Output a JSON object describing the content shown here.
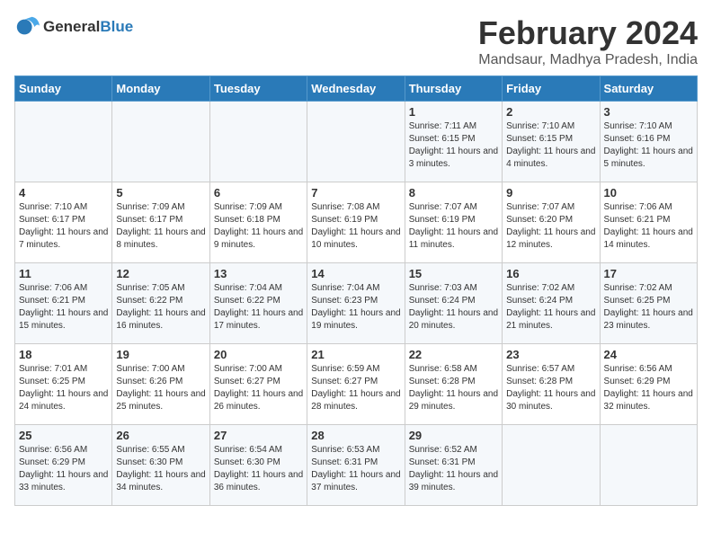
{
  "logo": {
    "general": "General",
    "blue": "Blue"
  },
  "title": "February 2024",
  "subtitle": "Mandsaur, Madhya Pradesh, India",
  "days_of_week": [
    "Sunday",
    "Monday",
    "Tuesday",
    "Wednesday",
    "Thursday",
    "Friday",
    "Saturday"
  ],
  "weeks": [
    [
      {
        "day": "",
        "info": ""
      },
      {
        "day": "",
        "info": ""
      },
      {
        "day": "",
        "info": ""
      },
      {
        "day": "",
        "info": ""
      },
      {
        "day": "1",
        "info": "Sunrise: 7:11 AM\nSunset: 6:15 PM\nDaylight: 11 hours and 3 minutes."
      },
      {
        "day": "2",
        "info": "Sunrise: 7:10 AM\nSunset: 6:15 PM\nDaylight: 11 hours and 4 minutes."
      },
      {
        "day": "3",
        "info": "Sunrise: 7:10 AM\nSunset: 6:16 PM\nDaylight: 11 hours and 5 minutes."
      }
    ],
    [
      {
        "day": "4",
        "info": "Sunrise: 7:10 AM\nSunset: 6:17 PM\nDaylight: 11 hours and 7 minutes."
      },
      {
        "day": "5",
        "info": "Sunrise: 7:09 AM\nSunset: 6:17 PM\nDaylight: 11 hours and 8 minutes."
      },
      {
        "day": "6",
        "info": "Sunrise: 7:09 AM\nSunset: 6:18 PM\nDaylight: 11 hours and 9 minutes."
      },
      {
        "day": "7",
        "info": "Sunrise: 7:08 AM\nSunset: 6:19 PM\nDaylight: 11 hours and 10 minutes."
      },
      {
        "day": "8",
        "info": "Sunrise: 7:07 AM\nSunset: 6:19 PM\nDaylight: 11 hours and 11 minutes."
      },
      {
        "day": "9",
        "info": "Sunrise: 7:07 AM\nSunset: 6:20 PM\nDaylight: 11 hours and 12 minutes."
      },
      {
        "day": "10",
        "info": "Sunrise: 7:06 AM\nSunset: 6:21 PM\nDaylight: 11 hours and 14 minutes."
      }
    ],
    [
      {
        "day": "11",
        "info": "Sunrise: 7:06 AM\nSunset: 6:21 PM\nDaylight: 11 hours and 15 minutes."
      },
      {
        "day": "12",
        "info": "Sunrise: 7:05 AM\nSunset: 6:22 PM\nDaylight: 11 hours and 16 minutes."
      },
      {
        "day": "13",
        "info": "Sunrise: 7:04 AM\nSunset: 6:22 PM\nDaylight: 11 hours and 17 minutes."
      },
      {
        "day": "14",
        "info": "Sunrise: 7:04 AM\nSunset: 6:23 PM\nDaylight: 11 hours and 19 minutes."
      },
      {
        "day": "15",
        "info": "Sunrise: 7:03 AM\nSunset: 6:24 PM\nDaylight: 11 hours and 20 minutes."
      },
      {
        "day": "16",
        "info": "Sunrise: 7:02 AM\nSunset: 6:24 PM\nDaylight: 11 hours and 21 minutes."
      },
      {
        "day": "17",
        "info": "Sunrise: 7:02 AM\nSunset: 6:25 PM\nDaylight: 11 hours and 23 minutes."
      }
    ],
    [
      {
        "day": "18",
        "info": "Sunrise: 7:01 AM\nSunset: 6:25 PM\nDaylight: 11 hours and 24 minutes."
      },
      {
        "day": "19",
        "info": "Sunrise: 7:00 AM\nSunset: 6:26 PM\nDaylight: 11 hours and 25 minutes."
      },
      {
        "day": "20",
        "info": "Sunrise: 7:00 AM\nSunset: 6:27 PM\nDaylight: 11 hours and 26 minutes."
      },
      {
        "day": "21",
        "info": "Sunrise: 6:59 AM\nSunset: 6:27 PM\nDaylight: 11 hours and 28 minutes."
      },
      {
        "day": "22",
        "info": "Sunrise: 6:58 AM\nSunset: 6:28 PM\nDaylight: 11 hours and 29 minutes."
      },
      {
        "day": "23",
        "info": "Sunrise: 6:57 AM\nSunset: 6:28 PM\nDaylight: 11 hours and 30 minutes."
      },
      {
        "day": "24",
        "info": "Sunrise: 6:56 AM\nSunset: 6:29 PM\nDaylight: 11 hours and 32 minutes."
      }
    ],
    [
      {
        "day": "25",
        "info": "Sunrise: 6:56 AM\nSunset: 6:29 PM\nDaylight: 11 hours and 33 minutes."
      },
      {
        "day": "26",
        "info": "Sunrise: 6:55 AM\nSunset: 6:30 PM\nDaylight: 11 hours and 34 minutes."
      },
      {
        "day": "27",
        "info": "Sunrise: 6:54 AM\nSunset: 6:30 PM\nDaylight: 11 hours and 36 minutes."
      },
      {
        "day": "28",
        "info": "Sunrise: 6:53 AM\nSunset: 6:31 PM\nDaylight: 11 hours and 37 minutes."
      },
      {
        "day": "29",
        "info": "Sunrise: 6:52 AM\nSunset: 6:31 PM\nDaylight: 11 hours and 39 minutes."
      },
      {
        "day": "",
        "info": ""
      },
      {
        "day": "",
        "info": ""
      }
    ]
  ]
}
